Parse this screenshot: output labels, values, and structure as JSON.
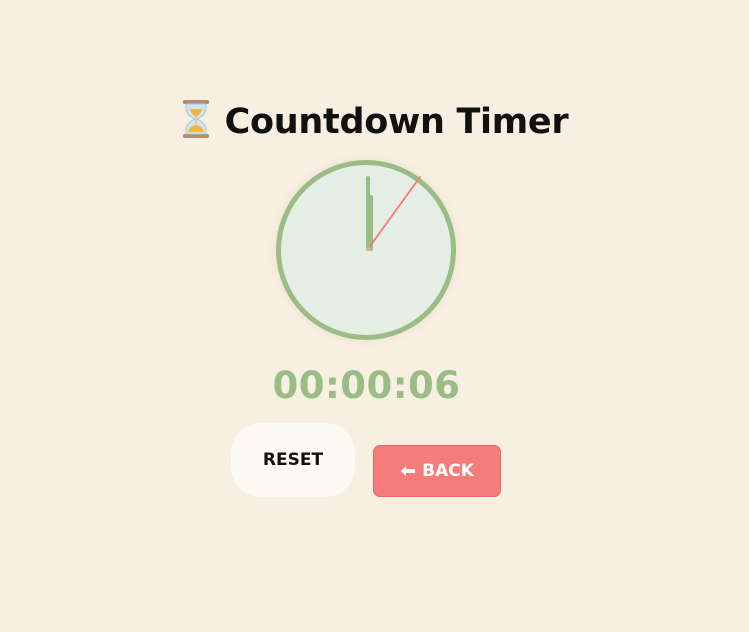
{
  "header": {
    "title": "Countdown Timer",
    "icon": "hourglass-icon"
  },
  "timer": {
    "display": "00:00:06",
    "remaining_seconds": 6,
    "colors": {
      "ring": "#99bd85",
      "face": "#e4eee5",
      "hand": "#99bd85",
      "second_hand": "#f07b78",
      "digits": "#99bd85"
    }
  },
  "controls": {
    "reset_label": "RESET",
    "back_label": "BACK",
    "back_icon": "left-arrow-icon",
    "back_color": "#f47d7c"
  },
  "theme": {
    "background": "#f8efe3"
  }
}
